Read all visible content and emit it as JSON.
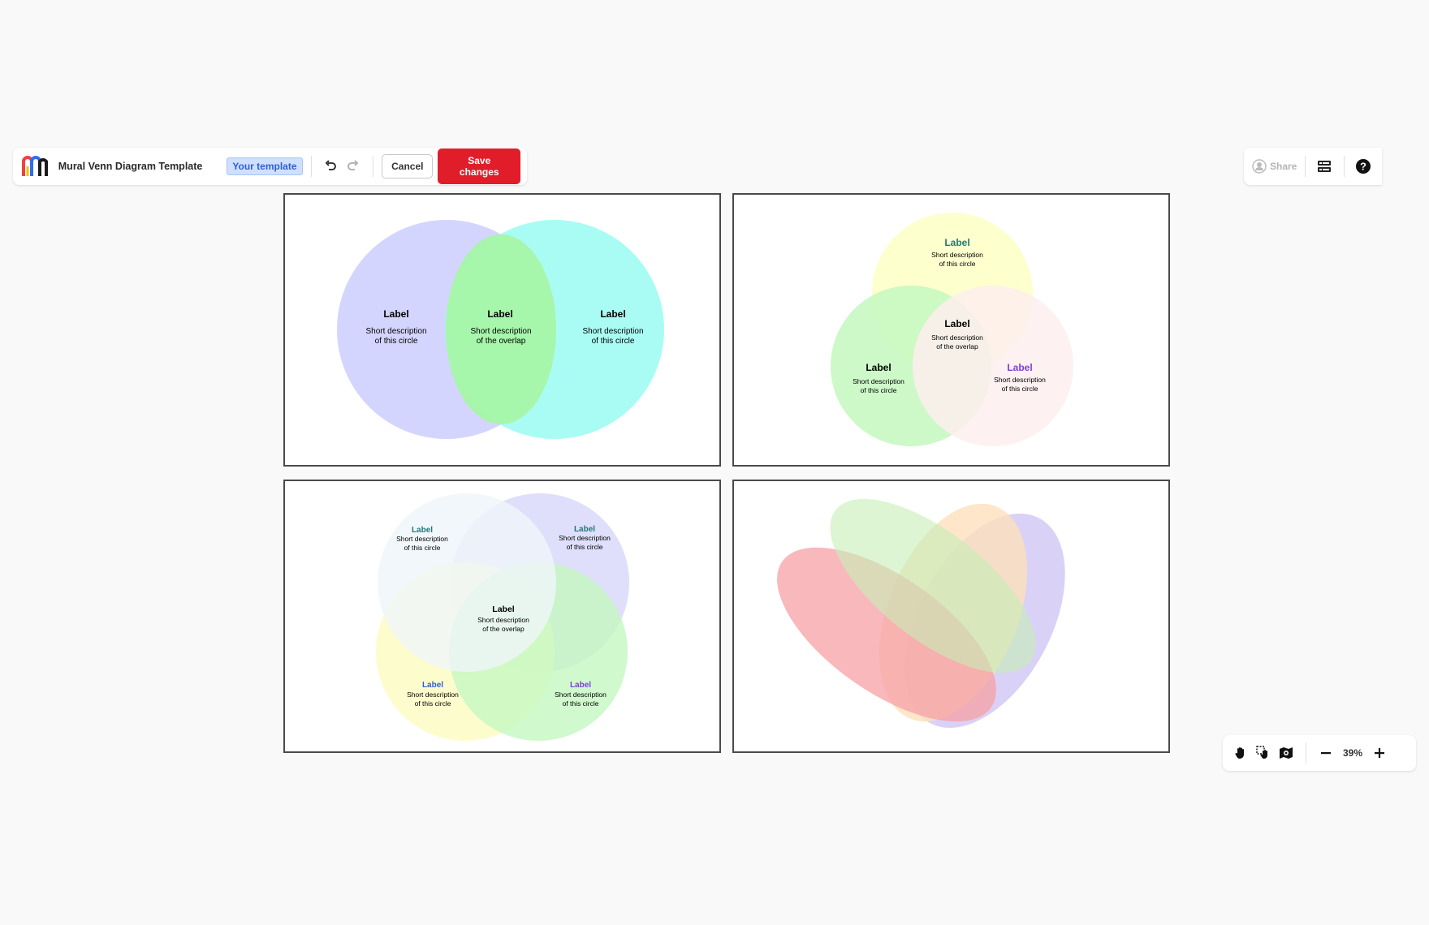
{
  "header": {
    "title": "Mural Venn Diagram Template",
    "badge": "Your template",
    "cancel_label": "Cancel",
    "save_label": "Save changes"
  },
  "right_toolbar": {
    "share_label": "Share"
  },
  "zoom": {
    "level": "39%"
  },
  "colors": {
    "save": "#e11d2a",
    "badge_bg": "#cfe0ff",
    "badge_text": "#2f5ed8"
  },
  "diagram1": {
    "left": {
      "label": "Label",
      "desc1": "Short description",
      "desc2": "of this circle"
    },
    "overlap": {
      "label": "Label",
      "desc1": "Short description",
      "desc2": "of the overlap"
    },
    "right": {
      "label": "Label",
      "desc1": "Short description",
      "desc2": "of this circle"
    }
  },
  "diagram2": {
    "top": {
      "label": "Label",
      "desc1": "Short description",
      "desc2": "of this circle"
    },
    "center": {
      "label": "Label",
      "desc1": "Short description",
      "desc2": "of the overlap"
    },
    "left": {
      "label": "Label",
      "desc1": "Short description",
      "desc2": "of this circle"
    },
    "right": {
      "label": "Label",
      "desc1": "Short description",
      "desc2": "of this circle"
    }
  },
  "diagram3": {
    "top_left": {
      "label": "Label",
      "desc1": "Short description",
      "desc2": "of this circle"
    },
    "top_right": {
      "label": "Label",
      "desc1": "Short description",
      "desc2": "of this circle"
    },
    "center": {
      "label": "Label",
      "desc1": "Short description",
      "desc2": "of the overlap"
    },
    "bottom_left": {
      "label": "Label",
      "desc1": "Short description",
      "desc2": "of this circle"
    },
    "bottom_right": {
      "label": "Label",
      "desc1": "Short description",
      "desc2": "of this circle"
    }
  }
}
